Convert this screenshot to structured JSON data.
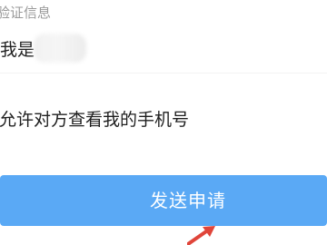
{
  "form": {
    "section_label": "验证信息",
    "verify_message": "我是",
    "permission_text": "允许对方查看我的手机号",
    "send_button_label": "发送申请"
  },
  "annotation": {
    "arrow_color": "#e0453a"
  },
  "theme": {
    "button_color": "#5aa9f5"
  }
}
